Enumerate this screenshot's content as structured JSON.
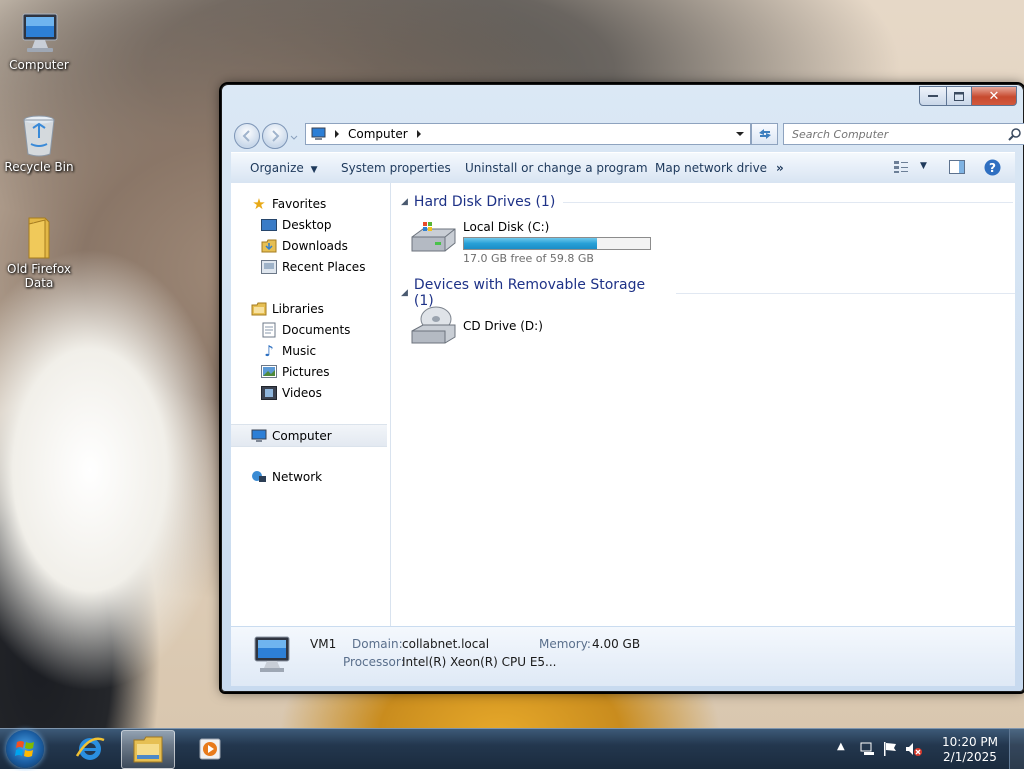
{
  "desktop": {
    "icons": [
      {
        "label": "Computer",
        "icon": "computer-icon"
      },
      {
        "label": "Recycle Bin",
        "icon": "recycle-bin-icon"
      },
      {
        "label": "Old Firefox Data",
        "icon": "folder-icon"
      }
    ]
  },
  "window": {
    "breadcrumb": "Computer",
    "search_placeholder": "Search Computer",
    "toolbar": {
      "organize": "Organize",
      "system_properties": "System properties",
      "uninstall": "Uninstall or change a program",
      "map_drive": "Map network drive",
      "more": "»"
    },
    "nav": {
      "favorites": "Favorites",
      "desktop": "Desktop",
      "downloads": "Downloads",
      "recent_places": "Recent Places",
      "libraries": "Libraries",
      "documents": "Documents",
      "music": "Music",
      "pictures": "Pictures",
      "videos": "Videos",
      "computer": "Computer",
      "network": "Network"
    },
    "groups": {
      "hdd_header": "Hard Disk Drives (1)",
      "removable_header": "Devices with Removable Storage (1)"
    },
    "drives": {
      "local": {
        "label": "Local Disk (C:)",
        "free_text": "17.0 GB free of 59.8 GB",
        "used_fraction": 0.716
      },
      "cd": {
        "label": "CD Drive (D:)"
      }
    },
    "details": {
      "name": "VM1",
      "domain_label": "Domain:",
      "domain_value": "collabnet.local",
      "memory_label": "Memory:",
      "memory_value": "4.00 GB",
      "processor_label": "Processor:",
      "processor_value": "Intel(R) Xeon(R) CPU E5..."
    }
  },
  "taskbar": {
    "time": "10:20 PM",
    "date": "2/1/2025"
  },
  "colors": {
    "link_blue": "#1e3287",
    "toolbar_text": "#1e395b",
    "progress": "#27a0d7",
    "close_red": "#c74a2f"
  }
}
